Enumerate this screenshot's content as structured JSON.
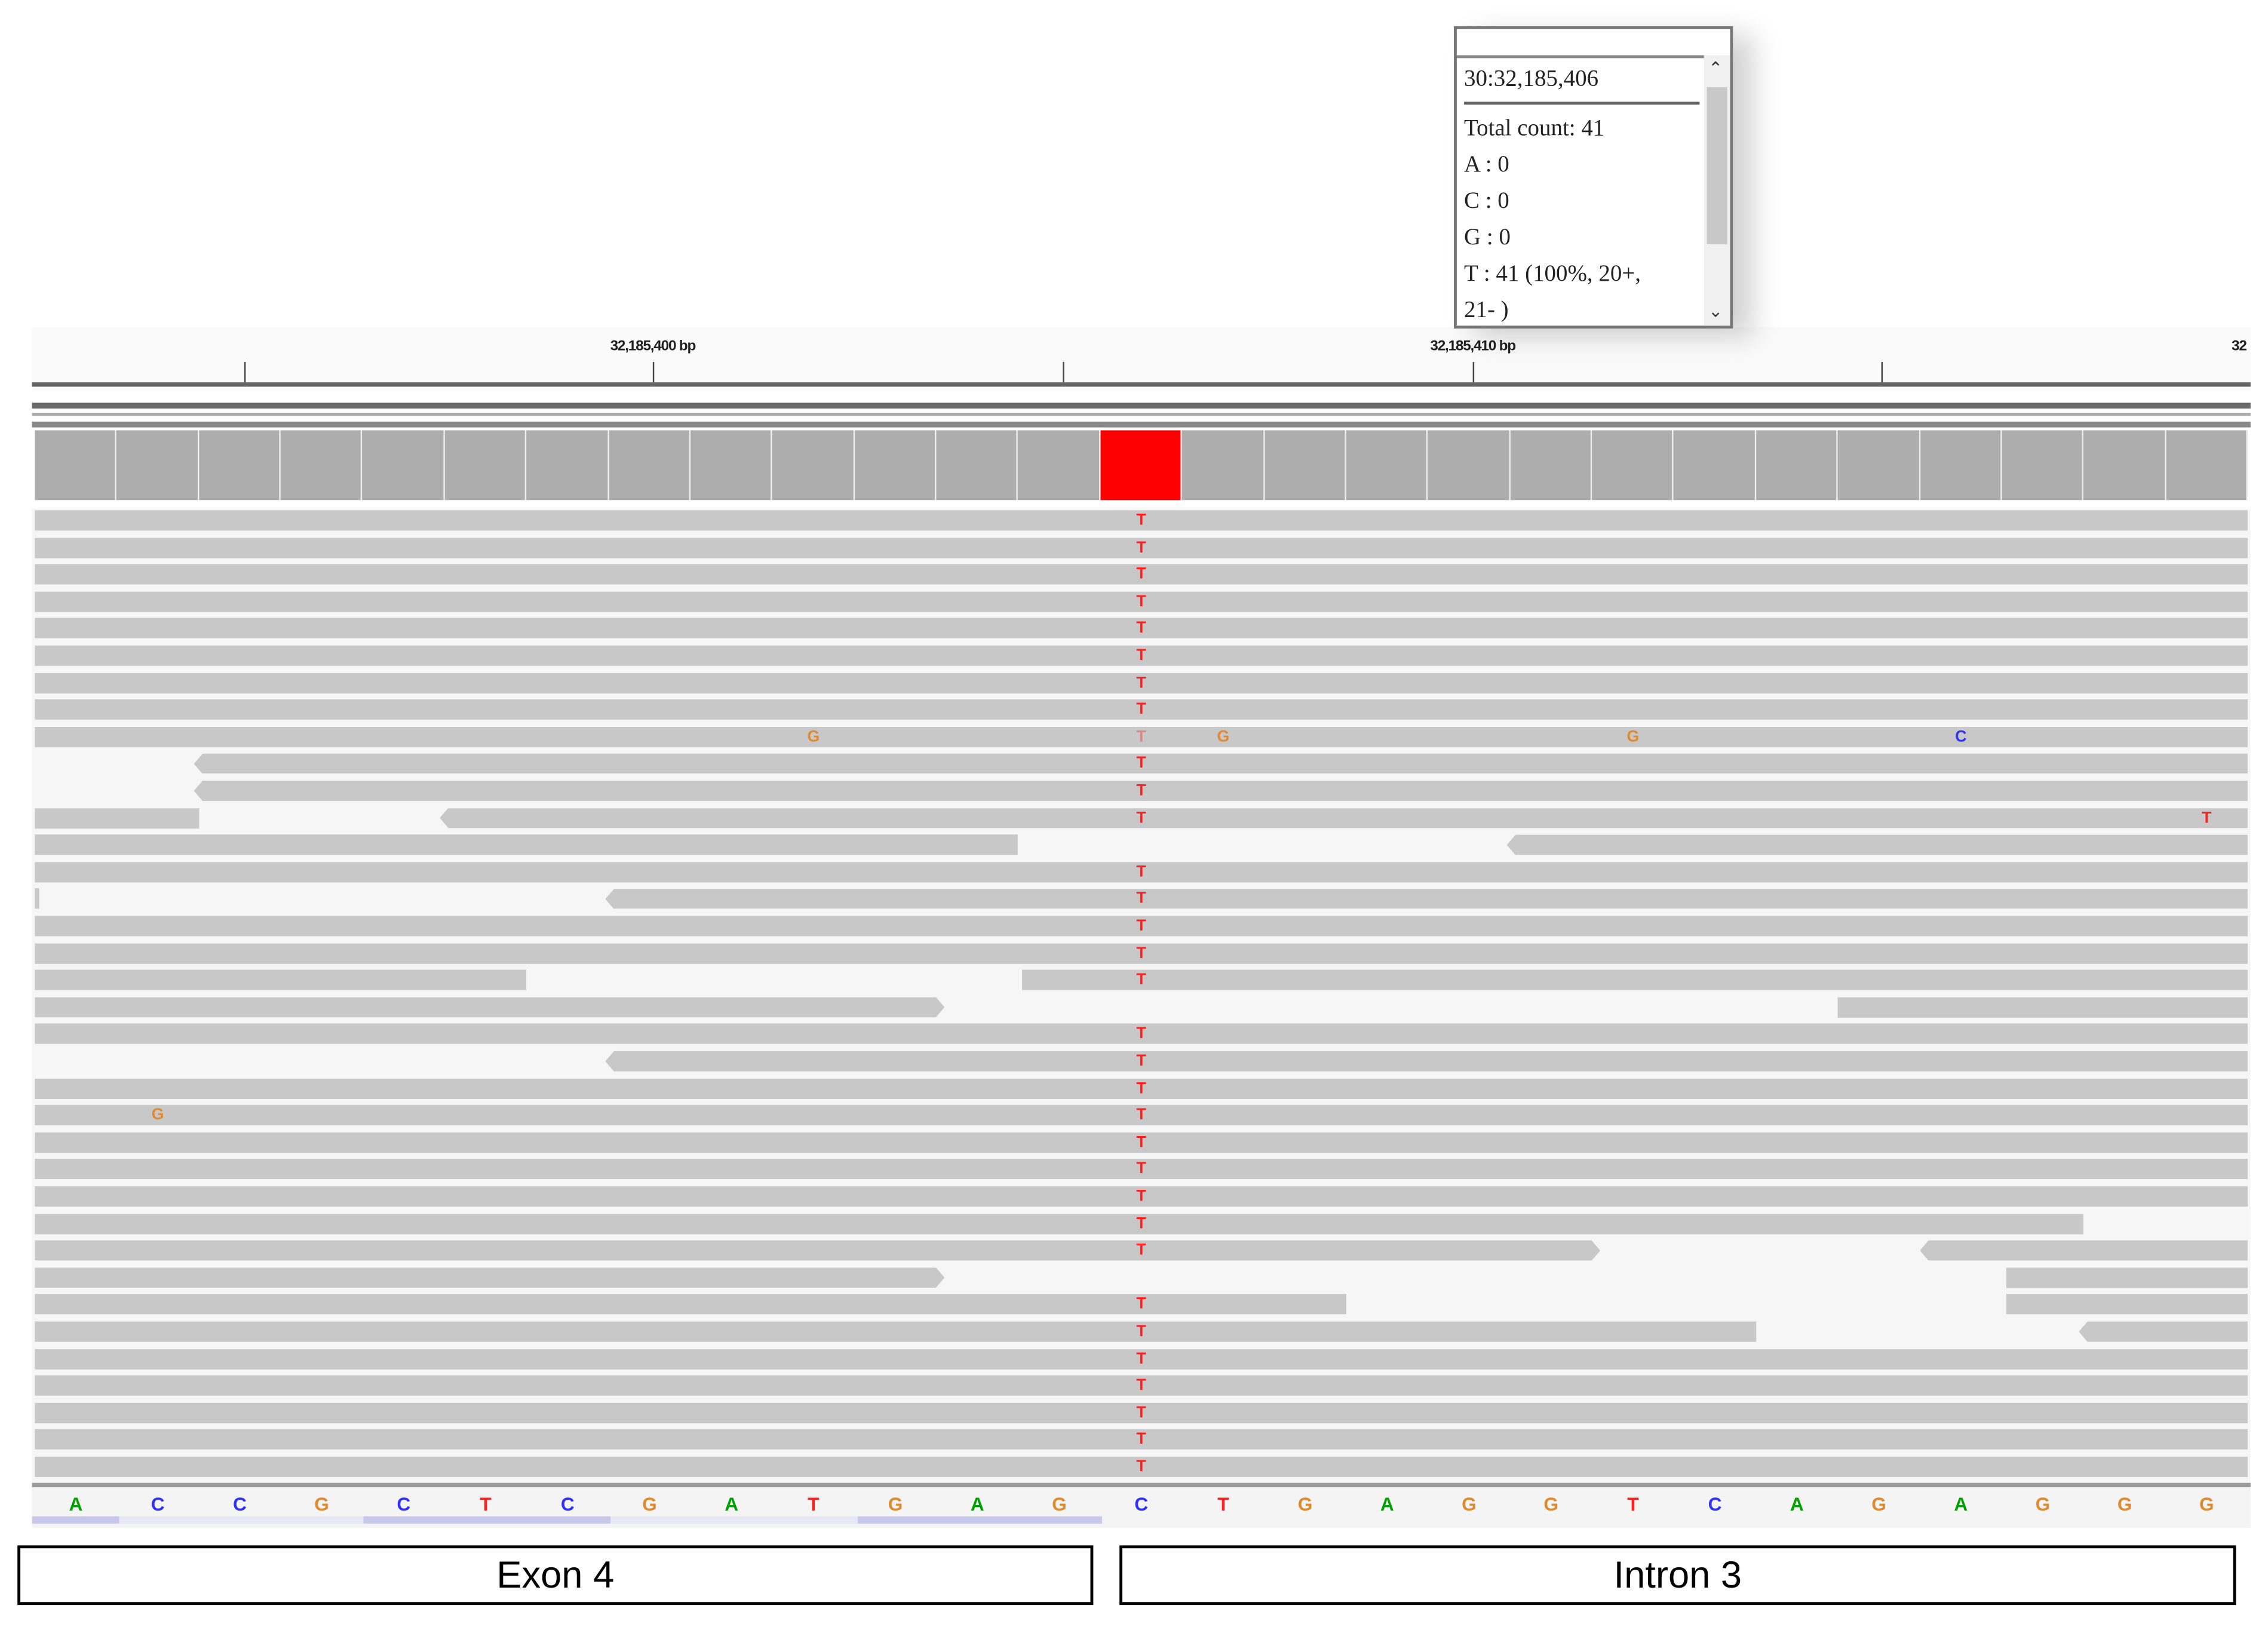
{
  "ruler": {
    "labels": [
      {
        "text": "32,185,400 bp",
        "tick": 1
      },
      {
        "text": "32,185,410 bp",
        "tick": 3
      },
      {
        "text": "32",
        "tick": 5
      }
    ],
    "tick_count": 5
  },
  "popup": {
    "position": "30:32,185,406",
    "total": "Total count: 41",
    "a": "A : 0",
    "c": "C : 0",
    "g": "G : 0",
    "t": "T : 41 (100%, 20+,",
    "t2": "21- )"
  },
  "colors": {
    "A": "#00a000",
    "C": "#3030ff",
    "G": "#e08a30",
    "T": "#ff2020",
    "read": "#c8c8c8",
    "coverage": "#adadad",
    "variant": "#ff0000"
  },
  "sequence": [
    "A",
    "C",
    "C",
    "G",
    "C",
    "T",
    "C",
    "G",
    "A",
    "T",
    "G",
    "A",
    "G",
    "C",
    "T",
    "G",
    "A",
    "G",
    "G",
    "T",
    "C",
    "A",
    "G",
    "A",
    "G",
    "G",
    "G"
  ],
  "variant_index": 13,
  "reads": [
    {
      "segs": [
        [
          0,
          27
        ]
      ],
      "mm": [
        [
          13,
          "T"
        ]
      ]
    },
    {
      "segs": [
        [
          0,
          27
        ]
      ],
      "mm": [
        [
          13,
          "T"
        ]
      ]
    },
    {
      "segs": [
        [
          0,
          27
        ]
      ],
      "mm": [
        [
          13,
          "T"
        ]
      ]
    },
    {
      "segs": [
        [
          0,
          27
        ]
      ],
      "mm": [
        [
          13,
          "T"
        ]
      ]
    },
    {
      "segs": [
        [
          0,
          27
        ]
      ],
      "mm": [
        [
          13,
          "T"
        ]
      ]
    },
    {
      "segs": [
        [
          0,
          27
        ]
      ],
      "mm": [
        [
          13,
          "T"
        ]
      ]
    },
    {
      "segs": [
        [
          0,
          27
        ]
      ],
      "mm": [
        [
          13,
          "T"
        ]
      ]
    },
    {
      "segs": [
        [
          0,
          27
        ]
      ],
      "mm": [
        [
          13,
          "T"
        ]
      ]
    },
    {
      "segs": [
        [
          0,
          27
        ]
      ],
      "mm": [
        [
          9,
          "G"
        ],
        [
          13,
          "T"
        ],
        [
          14,
          "G"
        ],
        [
          19,
          "G"
        ],
        [
          23,
          "C"
        ]
      ]
    },
    {
      "segs": [
        [
          1.94,
          27,
          "L"
        ]
      ],
      "mm": [
        [
          13,
          "T"
        ]
      ]
    },
    {
      "segs": [
        [
          1.94,
          27,
          "L"
        ]
      ],
      "mm": [
        [
          13,
          "T"
        ]
      ]
    },
    {
      "segs": [
        [
          0,
          2
        ],
        [
          4.94,
          27,
          "L"
        ]
      ],
      "mm": [
        [
          13,
          "T"
        ],
        [
          26,
          "T"
        ]
      ]
    },
    {
      "segs": [
        [
          0,
          12
        ],
        [
          17.96,
          27,
          "L"
        ]
      ],
      "mm": []
    },
    {
      "segs": [
        [
          0,
          27
        ]
      ],
      "mm": [
        [
          13,
          "T"
        ]
      ]
    },
    {
      "segs": [
        [
          0,
          0.05
        ],
        [
          6.96,
          27,
          "L"
        ]
      ],
      "mm": [
        [
          13,
          "T"
        ]
      ]
    },
    {
      "segs": [
        [
          0,
          27
        ]
      ],
      "mm": [
        [
          13,
          "T"
        ]
      ]
    },
    {
      "segs": [
        [
          0,
          27
        ]
      ],
      "mm": [
        [
          13,
          "T"
        ]
      ]
    },
    {
      "segs": [
        [
          0,
          6
        ],
        [
          12.04,
          27
        ]
      ],
      "mm": [
        [
          13,
          "T"
        ]
      ]
    },
    {
      "segs": [
        [
          0,
          11.1,
          "R"
        ],
        [
          22,
          27
        ]
      ],
      "mm": []
    },
    {
      "segs": [
        [
          0,
          27
        ]
      ],
      "mm": [
        [
          13,
          "T"
        ]
      ]
    },
    {
      "segs": [
        [
          6.96,
          27,
          "L"
        ]
      ],
      "mm": [
        [
          13,
          "T"
        ]
      ]
    },
    {
      "segs": [
        [
          0,
          27
        ]
      ],
      "mm": [
        [
          13,
          "T"
        ]
      ]
    },
    {
      "segs": [
        [
          0,
          27
        ]
      ],
      "mm": [
        [
          1,
          "G"
        ],
        [
          13,
          "T"
        ]
      ]
    },
    {
      "segs": [
        [
          0,
          27
        ]
      ],
      "mm": [
        [
          13,
          "T"
        ]
      ]
    },
    {
      "segs": [
        [
          0,
          27
        ]
      ],
      "mm": [
        [
          13,
          "T"
        ]
      ]
    },
    {
      "segs": [
        [
          0,
          27
        ]
      ],
      "mm": [
        [
          13,
          "T"
        ]
      ]
    },
    {
      "segs": [
        [
          0,
          25
        ]
      ],
      "mm": [
        [
          13,
          "T"
        ]
      ]
    },
    {
      "segs": [
        [
          0,
          19.1,
          "R"
        ],
        [
          23,
          27,
          "L"
        ]
      ],
      "mm": [
        [
          13,
          "T"
        ]
      ]
    },
    {
      "segs": [
        [
          0,
          11.1,
          "R"
        ],
        [
          24.05,
          27
        ]
      ],
      "mm": []
    },
    {
      "segs": [
        [
          0,
          16
        ],
        [
          24.05,
          27
        ]
      ],
      "mm": [
        [
          13,
          "T"
        ]
      ]
    },
    {
      "segs": [
        [
          0,
          21
        ],
        [
          24.94,
          27,
          "L"
        ]
      ],
      "mm": [
        [
          13,
          "T"
        ]
      ]
    },
    {
      "segs": [
        [
          0,
          27
        ]
      ],
      "mm": [
        [
          13,
          "T"
        ]
      ]
    },
    {
      "segs": [
        [
          0,
          27
        ]
      ],
      "mm": [
        [
          13,
          "T"
        ]
      ]
    },
    {
      "segs": [
        [
          0,
          27
        ]
      ],
      "mm": [
        [
          13,
          "T"
        ]
      ]
    },
    {
      "segs": [
        [
          0,
          27
        ]
      ],
      "mm": [
        [
          13,
          "T"
        ]
      ]
    },
    {
      "segs": [
        [
          0,
          27
        ]
      ],
      "mm": [
        [
          13,
          "T"
        ]
      ]
    }
  ],
  "regions": {
    "exon": "Exon 4",
    "intron": "Intron 3"
  }
}
